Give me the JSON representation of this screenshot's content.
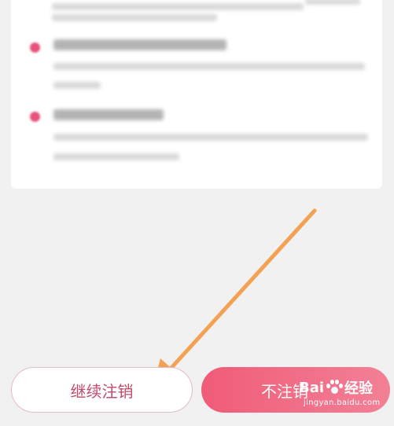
{
  "buttons": {
    "continue_label": "继续注销",
    "cancel_label": "不注销"
  },
  "watermark": {
    "brand": "Bai",
    "brand_suffix": "经验",
    "url": "jingyan.baidu.com"
  },
  "colors": {
    "accent": "#e9537a",
    "cancel_gradient_start": "#f05472",
    "cancel_gradient_end": "#f37b92",
    "arrow": "#f4a154",
    "continue_text": "#c24a68"
  },
  "icons": {
    "bullet": "pink-dot-icon",
    "arrow": "orange-arrow-annotation",
    "watermark": "baidu-paw-icon"
  }
}
